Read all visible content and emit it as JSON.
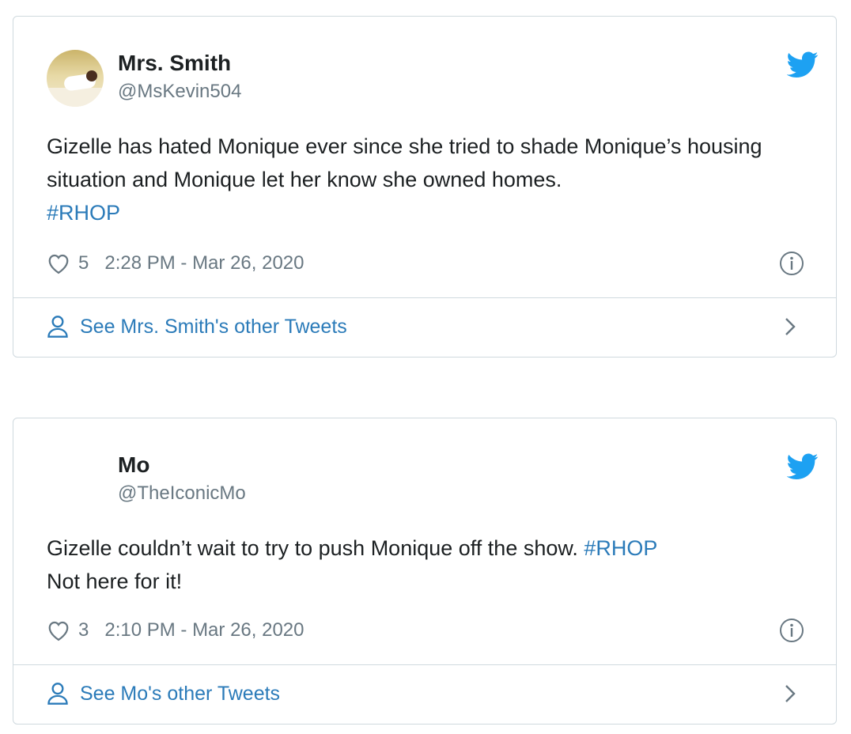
{
  "colors": {
    "link": "#2b7bb9",
    "muted": "#697882",
    "text": "#1c2022",
    "twitter_blue": "#1da1f2",
    "border": "#cfd9de"
  },
  "tweets": [
    {
      "author_name": "Mrs. Smith",
      "author_handle": "@MsKevin504",
      "text": "Gizelle has hated Monique ever since she tried to shade Monique’s housing situation and Monique let her know she owned homes.",
      "hashtag": "#RHOP",
      "trailing_text": "",
      "likes": "5",
      "timestamp": "2:28 PM - Mar 26, 2020",
      "footer_link": "See Mrs. Smith's other Tweets",
      "has_avatar": true
    },
    {
      "author_name": "Mo",
      "author_handle": "@TheIconicMo",
      "text": "Gizelle couldn’t wait to try to push Monique off the show.",
      "hashtag": "#RHOP",
      "trailing_text": "Not here for it!",
      "likes": "3",
      "timestamp": "2:10 PM - Mar 26, 2020",
      "footer_link": "See Mo's other Tweets",
      "has_avatar": false
    }
  ],
  "icons": {
    "brand": "twitter-bird-icon",
    "like": "heart-icon",
    "info": "info-icon",
    "profile": "person-icon",
    "navigate": "chevron-right-icon"
  }
}
